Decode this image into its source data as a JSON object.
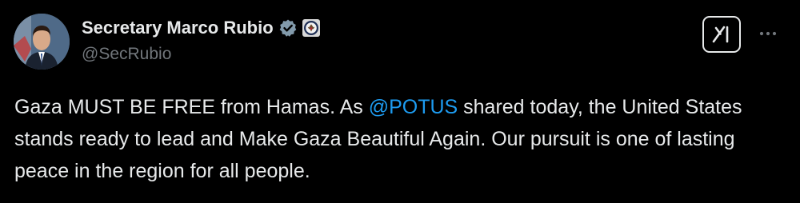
{
  "author": {
    "display_name": "Secretary Marco Rubio",
    "handle": "@SecRubio",
    "verified": true
  },
  "icons": {
    "verified": "verified-badge-icon",
    "affiliation": "state-department-seal-icon",
    "grok": "grok-icon",
    "more": "more-options-icon"
  },
  "tweet": {
    "text_part1": "Gaza MUST BE FREE from Hamas. As ",
    "mention": "@POTUS",
    "text_part2": " shared today, the United States stands ready to lead and Make Gaza Beautiful Again. Our pursuit is one of lasting peace in the region for all people."
  },
  "colors": {
    "background": "#000000",
    "text": "#e7e9ea",
    "secondary_text": "#71767b",
    "link": "#1d9bf0",
    "verified_badge": "#829aab"
  }
}
